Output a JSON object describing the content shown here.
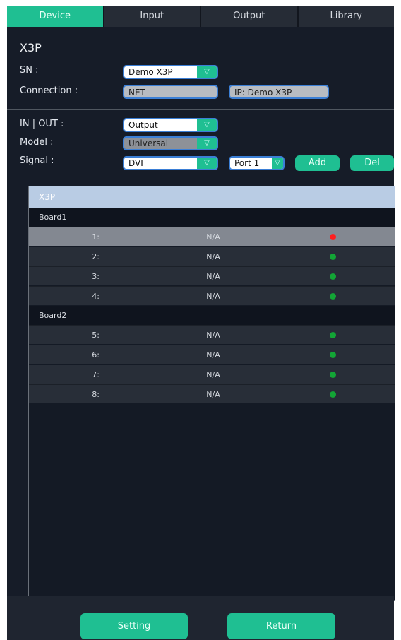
{
  "tabs": [
    {
      "label": "Device",
      "active": true
    },
    {
      "label": "Input",
      "active": false
    },
    {
      "label": "Output",
      "active": false
    },
    {
      "label": "Library",
      "active": false
    }
  ],
  "device_title": "X3P",
  "sn": {
    "label": "SN :",
    "value": "Demo X3P"
  },
  "connection": {
    "label": "Connection :",
    "type": "NET",
    "ip": "IP: Demo X3P"
  },
  "in_out": {
    "label": "IN | OUT :",
    "value": "Output"
  },
  "model": {
    "label": "Model :",
    "value": "Universal"
  },
  "signal": {
    "label": "Signal :",
    "value": "DVI",
    "port": "Port 1",
    "add_label": "Add",
    "del_label": "Del"
  },
  "list": {
    "header": "X3P",
    "boards": [
      {
        "name": "Board1",
        "ports": [
          {
            "num": "1:",
            "value": "N/A",
            "status": "red",
            "selected": true
          },
          {
            "num": "2:",
            "value": "N/A",
            "status": "green",
            "selected": false
          },
          {
            "num": "3:",
            "value": "N/A",
            "status": "green",
            "selected": false
          },
          {
            "num": "4:",
            "value": "N/A",
            "status": "green",
            "selected": false
          }
        ]
      },
      {
        "name": "Board2",
        "ports": [
          {
            "num": "5:",
            "value": "N/A",
            "status": "green",
            "selected": false
          },
          {
            "num": "6:",
            "value": "N/A",
            "status": "green",
            "selected": false
          },
          {
            "num": "7:",
            "value": "N/A",
            "status": "green",
            "selected": false
          },
          {
            "num": "8:",
            "value": "N/A",
            "status": "green",
            "selected": false
          }
        ]
      }
    ]
  },
  "footer": {
    "setting_label": "Setting",
    "return_label": "Return"
  },
  "colors": {
    "accent": "#1fbf92",
    "status_red": "#ff1f1f",
    "status_green": "#13a536",
    "icon_arrow": "▽"
  }
}
